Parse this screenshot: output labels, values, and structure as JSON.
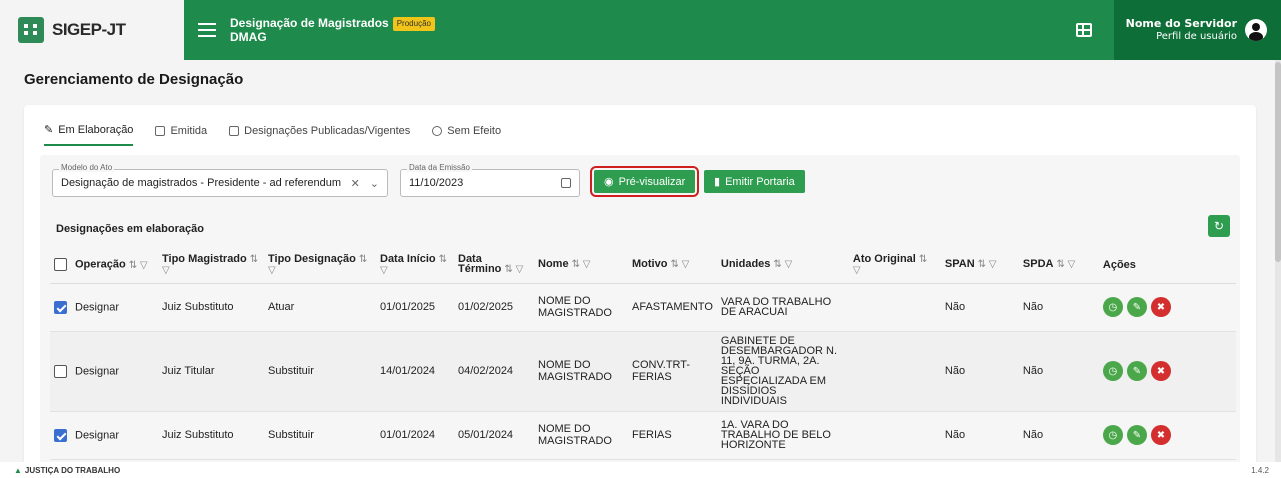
{
  "header": {
    "app_name": "SIGEP-JT",
    "module_title": "Designação de Magistrados",
    "module_sub": "DMAG",
    "env_badge": "Produção",
    "user_name": "Nome do Servidor",
    "user_role": "Perfil de usuário",
    "colors": {
      "bar": "#1e8a4c",
      "user": "#0e6e37",
      "badge": "#f0c419"
    }
  },
  "page": {
    "title": "Gerenciamento de Designação"
  },
  "tabs": [
    {
      "label": "Em Elaboração",
      "icon": "people-edit-icon",
      "active": true
    },
    {
      "label": "Emitida",
      "icon": "document-icon",
      "active": false
    },
    {
      "label": "Designações Publicadas/Vigentes",
      "icon": "calendar-icon",
      "active": false
    },
    {
      "label": "Sem Efeito",
      "icon": "minus-circle-icon",
      "active": false
    }
  ],
  "filters": {
    "modelo_label": "Modelo do Ato",
    "modelo_value": "Designação de magistrados - Presidente - ad referendum",
    "data_label": "Data da Emissão",
    "data_value": "11/10/2023"
  },
  "actions": {
    "preview": "Pré-visualizar",
    "emit": "Emitir Portaria"
  },
  "section": {
    "title": "Designações em elaboração"
  },
  "columns": [
    "Operação",
    "Tipo Magistrado",
    "Tipo Designação",
    "Data Início",
    "Data Término",
    "Nome",
    "Motivo",
    "Unidades",
    "Ato Original",
    "SPAN",
    "SPDA",
    "Ações"
  ],
  "rows": [
    {
      "checked": true,
      "operacao": "Designar",
      "tipo_mag": "Juiz Substituto",
      "tipo_des": "Atuar",
      "inicio": "01/01/2025",
      "termino": "01/02/2025",
      "nome": "NOME DO MAGISTRADO",
      "motivo": "AFASTAMENTO",
      "unidades": "VARA DO TRABALHO DE ARACUAI",
      "ato": "",
      "span": "Não",
      "spda": "Não"
    },
    {
      "checked": false,
      "operacao": "Designar",
      "tipo_mag": "Juiz Titular",
      "tipo_des": "Substituir",
      "inicio": "14/01/2024",
      "termino": "04/02/2024",
      "nome": "NOME DO MAGISTRADO",
      "motivo": "CONV.TRT-FERIAS",
      "unidades": "GABINETE DE DESEMBARGADOR N. 11, 9A. TURMA, 2A. SEÇÃO ESPECIALIZADA EM DISSÍDIOS INDIVIDUAIS",
      "ato": "",
      "span": "Não",
      "spda": "Não"
    },
    {
      "checked": true,
      "operacao": "Designar",
      "tipo_mag": "Juiz Substituto",
      "tipo_des": "Substituir",
      "inicio": "01/01/2024",
      "termino": "05/01/2024",
      "nome": "NOME DO MAGISTRADO",
      "motivo": "FERIAS",
      "unidades": "1A. VARA DO TRABALHO DE BELO HORIZONTE",
      "ato": "",
      "span": "Não",
      "spda": "Não"
    }
  ],
  "footer": {
    "brand": "JUSTIÇA DO TRABALHO",
    "version": "1.4.2"
  }
}
